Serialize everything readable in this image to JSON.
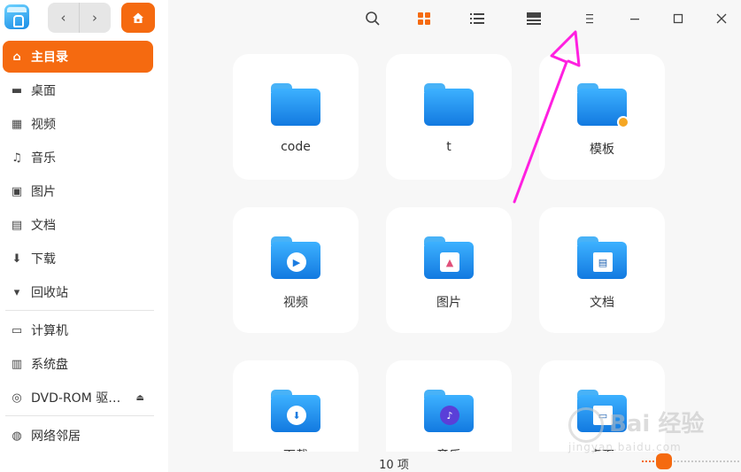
{
  "sidebar": {
    "items": [
      {
        "label": "主目录",
        "icon": "home-icon",
        "active": true
      },
      {
        "label": "桌面",
        "icon": "desktop-icon"
      },
      {
        "label": "视频",
        "icon": "video-icon"
      },
      {
        "label": "音乐",
        "icon": "music-icon"
      },
      {
        "label": "图片",
        "icon": "picture-icon"
      },
      {
        "label": "文档",
        "icon": "document-icon"
      },
      {
        "label": "下载",
        "icon": "download-icon"
      },
      {
        "label": "回收站",
        "icon": "trash-icon"
      },
      {
        "label": "计算机",
        "icon": "computer-icon"
      },
      {
        "label": "系统盘",
        "icon": "disk-icon"
      },
      {
        "label": "DVD-ROM 驱…",
        "icon": "dvd-icon"
      },
      {
        "label": "网络邻居",
        "icon": "network-icon"
      }
    ]
  },
  "files": [
    {
      "label": "code",
      "emblem": ""
    },
    {
      "label": "t",
      "emblem": ""
    },
    {
      "label": "模板",
      "emblem": "lock"
    },
    {
      "label": "视频",
      "emblem": "video"
    },
    {
      "label": "图片",
      "emblem": "picture"
    },
    {
      "label": "文档",
      "emblem": "document"
    },
    {
      "label": "下载",
      "emblem": "download"
    },
    {
      "label": "音乐",
      "emblem": "music"
    },
    {
      "label": "桌面",
      "emblem": "desktop"
    }
  ],
  "status": {
    "count": "10 项"
  },
  "colors": {
    "accent": "#f56a10",
    "folder": "#1a8de6",
    "arrow": "#ff20e0"
  },
  "watermark": {
    "big": "Bai 经验",
    "small": "jingyan.baidu.com"
  }
}
